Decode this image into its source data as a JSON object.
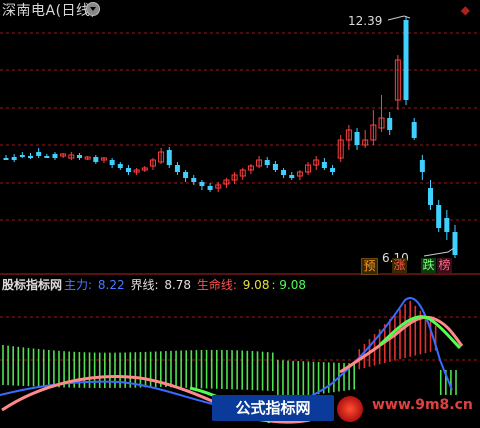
{
  "header": {
    "title": "深南电A(日线)",
    "arrow": "◆"
  },
  "prices": {
    "high": "12.39",
    "low": "6.10"
  },
  "markers": [
    "预",
    "涨",
    "跌",
    "榜"
  ],
  "indicator": {
    "title": "股标指标网",
    "main_label": "主力:",
    "main_value": "8.22",
    "boundary_label": "界线:",
    "boundary_value": "8.78",
    "life_label": "生命线:",
    "life_value": "9.08",
    "life_value2": ": 9.08"
  },
  "watermark": {
    "text": "公式指标网",
    "url": "www.9m8.cn"
  },
  "colors": {
    "up": "#ff4040",
    "down": "#40d0ff",
    "grid": "#a01818",
    "green": "#50e050"
  }
}
